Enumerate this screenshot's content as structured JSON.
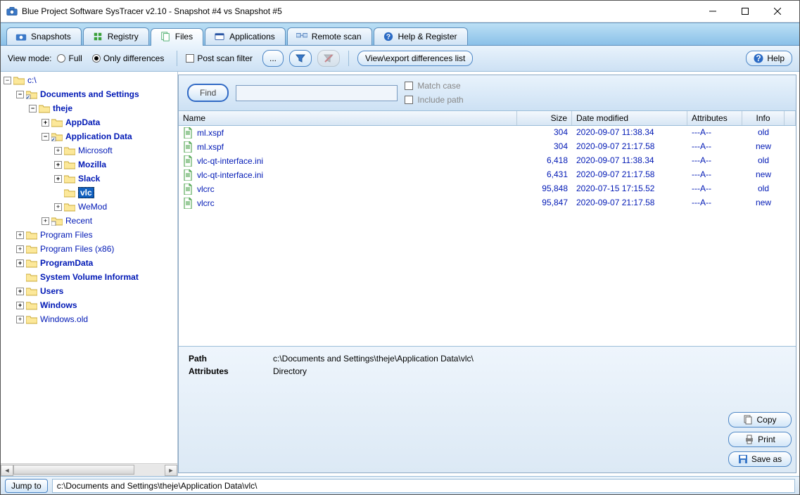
{
  "window": {
    "title": "Blue Project Software SysTracer v2.10 - Snapshot #4 vs Snapshot #5"
  },
  "tabs": [
    {
      "label": "Snapshots"
    },
    {
      "label": "Registry"
    },
    {
      "label": "Files"
    },
    {
      "label": "Applications"
    },
    {
      "label": "Remote scan"
    },
    {
      "label": "Help & Register"
    }
  ],
  "toolbar": {
    "view_mode": "View mode:",
    "full": "Full",
    "only_diff": "Only differences",
    "post_scan": "Post scan filter",
    "view_export": "View\\export differences list",
    "ellipsis": "...",
    "help": "Help"
  },
  "tree": {
    "root": "c:\\",
    "docs": "Documents and Settings",
    "theje": "theje",
    "appdata": "AppData",
    "appldata": "Application Data",
    "microsoft": "Microsoft",
    "mozilla": "Mozilla",
    "slack": "Slack",
    "vlc": "vlc",
    "wemod": "WeMod",
    "recent": "Recent",
    "progfiles": "Program Files",
    "progfilesx86": "Program Files (x86)",
    "programdata": "ProgramData",
    "svinfo": "System Volume Informat",
    "users": "Users",
    "windows": "Windows",
    "windowsold": "Windows.old"
  },
  "find": {
    "btn": "Find",
    "match_case": "Match case",
    "include_path": "Include path"
  },
  "columns": {
    "name": "Name",
    "size": "Size",
    "date": "Date modified",
    "attr": "Attributes",
    "info": "Info"
  },
  "rows": [
    {
      "name": "ml.xspf",
      "size": "304",
      "date": "2020-09-07 11:38.34",
      "attr": "---A--",
      "info": "old"
    },
    {
      "name": "ml.xspf",
      "size": "304",
      "date": "2020-09-07 21:17.58",
      "attr": "---A--",
      "info": "new"
    },
    {
      "name": "vlc-qt-interface.ini",
      "size": "6,418",
      "date": "2020-09-07 11:38.34",
      "attr": "---A--",
      "info": "old"
    },
    {
      "name": "vlc-qt-interface.ini",
      "size": "6,431",
      "date": "2020-09-07 21:17.58",
      "attr": "---A--",
      "info": "new"
    },
    {
      "name": "vlcrc",
      "size": "95,848",
      "date": "2020-07-15 17:15.52",
      "attr": "---A--",
      "info": "old"
    },
    {
      "name": "vlcrc",
      "size": "95,847",
      "date": "2020-09-07 21:17.58",
      "attr": "---A--",
      "info": "new"
    }
  ],
  "detail": {
    "path_lbl": "Path",
    "path_val": "c:\\Documents and Settings\\theje\\Application Data\\vlc\\",
    "attr_lbl": "Attributes",
    "attr_val": "Directory",
    "copy": "Copy",
    "print": "Print",
    "saveas": "Save as"
  },
  "jump": {
    "btn": "Jump to",
    "path": "c:\\Documents and Settings\\theje\\Application Data\\vlc\\"
  }
}
